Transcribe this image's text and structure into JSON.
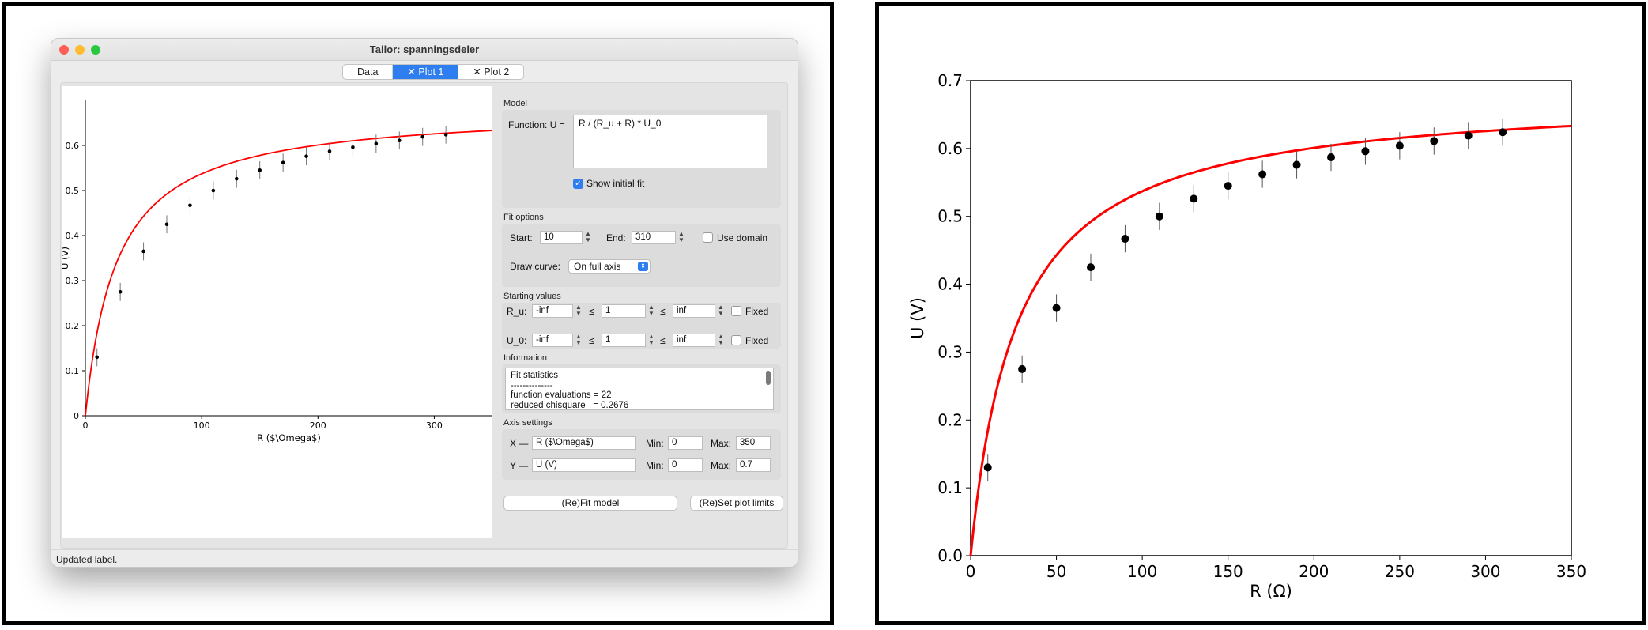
{
  "window": {
    "title": "Tailor: spanningsdeler",
    "traffic_colors": [
      "#fe5f57",
      "#febc2e",
      "#28c840"
    ]
  },
  "tabs": [
    {
      "label": "Data",
      "active": false
    },
    {
      "label": "Plot 1",
      "active": true,
      "close_glyph": "✕"
    },
    {
      "label": "Plot 2",
      "active": false,
      "close_glyph": "✕"
    }
  ],
  "model": {
    "section": "Model",
    "function_label": "Function:  U =",
    "function_value": "R / (R_u + R) * U_0",
    "show_initial_fit_label": "Show initial fit",
    "show_initial_fit": true
  },
  "fit_options": {
    "section": "Fit options",
    "start_label": "Start:",
    "start_value": "10",
    "end_label": "End:",
    "end_value": "310",
    "use_domain_label": "Use domain",
    "draw_curve_label": "Draw curve:",
    "draw_curve_value": "On full axis"
  },
  "starting_values": {
    "section": "Starting values",
    "le": "≤",
    "fixed_label": "Fixed",
    "params": [
      {
        "name": "R_u:",
        "min": "-inf",
        "value": "1",
        "max": "inf"
      },
      {
        "name": "U_0:",
        "min": "-inf",
        "value": "1",
        "max": "inf"
      }
    ]
  },
  "information": {
    "section": "Information",
    "lines": [
      "Fit statistics",
      "--------------",
      "function evaluations = 22",
      "reduced chisquare   = 0.2676"
    ]
  },
  "axis_settings": {
    "section": "Axis settings",
    "min_label": "Min:",
    "max_label": "Max:",
    "x": {
      "axis": "X —",
      "label": "R ($\\Omega$)",
      "min": "0",
      "max": "350"
    },
    "y": {
      "axis": "Y —",
      "label": "U (V)",
      "min": "0",
      "max": "0.7"
    }
  },
  "buttons": {
    "refit": "(Re)Fit model",
    "set_limits": "(Re)Set plot limits"
  },
  "status": "Updated label.",
  "chart_data": [
    {
      "type": "scatter",
      "xlabel": "R ($\\Omega$)",
      "ylabel": "U (V)",
      "xlim": [
        0,
        350
      ],
      "ylim": [
        0,
        0.7
      ],
      "xticks": [
        0,
        100,
        200,
        300
      ],
      "yticks": [
        0,
        0.1,
        0.2,
        0.3,
        0.4,
        0.5,
        0.6
      ],
      "ytick_labels": [
        "0",
        "0.1",
        "0.2",
        "0.3",
        "0.4",
        "0.5",
        "0.6"
      ],
      "xtick_labels": [
        "0",
        "100",
        "200",
        "300"
      ],
      "x": [
        10,
        30,
        50,
        70,
        90,
        110,
        130,
        150,
        170,
        190,
        210,
        230,
        250,
        270,
        290,
        310
      ],
      "y": [
        0.13,
        0.275,
        0.365,
        0.425,
        0.467,
        0.5,
        0.526,
        0.545,
        0.562,
        0.576,
        0.587,
        0.596,
        0.604,
        0.611,
        0.619,
        0.624
      ],
      "yerr": 0.02,
      "fit": {
        "function": "R / (R_u + R) * U_0",
        "R_u": 27,
        "U_0": 0.682,
        "color": "#ff0000"
      },
      "grid": false
    },
    {
      "type": "scatter",
      "xlabel": "R (Ω)",
      "ylabel": "U (V)",
      "xlim": [
        0,
        350
      ],
      "ylim": [
        0,
        0.7
      ],
      "xticks": [
        0,
        50,
        100,
        150,
        200,
        250,
        300,
        350
      ],
      "yticks": [
        0,
        0.1,
        0.2,
        0.3,
        0.4,
        0.5,
        0.6,
        0.7
      ],
      "ytick_labels": [
        "0.0",
        "0.1",
        "0.2",
        "0.3",
        "0.4",
        "0.5",
        "0.6",
        "0.7"
      ],
      "xtick_labels": [
        "0",
        "50",
        "100",
        "150",
        "200",
        "250",
        "300",
        "350"
      ],
      "x": [
        10,
        30,
        50,
        70,
        90,
        110,
        130,
        150,
        170,
        190,
        210,
        230,
        250,
        270,
        290,
        310
      ],
      "y": [
        0.13,
        0.275,
        0.365,
        0.425,
        0.467,
        0.5,
        0.526,
        0.545,
        0.562,
        0.576,
        0.587,
        0.596,
        0.604,
        0.611,
        0.619,
        0.624
      ],
      "yerr": 0.02,
      "fit": {
        "function": "R / (R_u + R) * U_0",
        "R_u": 27,
        "U_0": 0.682,
        "color": "#ff0000"
      },
      "grid": false
    }
  ]
}
